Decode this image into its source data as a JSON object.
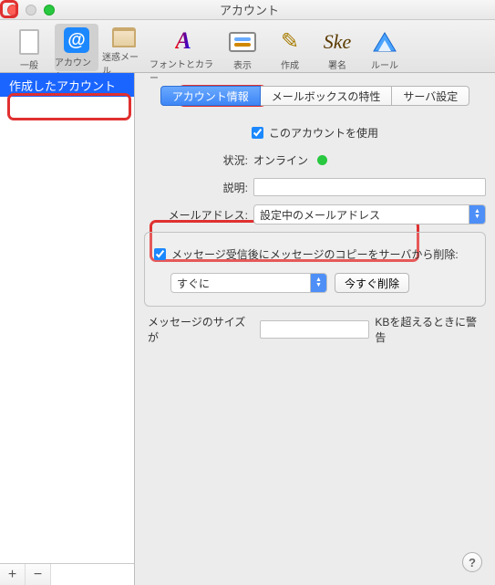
{
  "window": {
    "title": "アカウント"
  },
  "toolbar": [
    {
      "key": "general",
      "label": "一般"
    },
    {
      "key": "accounts",
      "label": "アカウント",
      "selected": true
    },
    {
      "key": "junk",
      "label": "迷惑メール"
    },
    {
      "key": "fonts",
      "label": "フォントとカラー"
    },
    {
      "key": "viewing",
      "label": "表示"
    },
    {
      "key": "compose",
      "label": "作成"
    },
    {
      "key": "sign",
      "label": "署名"
    },
    {
      "key": "rules",
      "label": "ルール"
    }
  ],
  "sidebar": {
    "items": [
      {
        "label": "作成したアカウント",
        "selected": true
      }
    ],
    "add": "+",
    "remove": "−"
  },
  "tabs": [
    {
      "label": "アカウント情報",
      "selected": true
    },
    {
      "label": "メールボックスの特性"
    },
    {
      "label": "サーバ設定"
    }
  ],
  "form": {
    "use_account_label": "このアカウントを使用",
    "use_account_checked": true,
    "status_label": "状況:",
    "status_value": "オンライン",
    "desc_label": "説明:",
    "desc_value": "",
    "email_label": "メールアドレス:",
    "email_value": "設定中のメールアドレス",
    "remove_copies_checked": true,
    "remove_copies_label": "メッセージ受信後にメッセージのコピーをサーバから削除:",
    "remove_when_value": "すぐに",
    "remove_now_label": "今すぐ削除",
    "size_limit_prefix": "メッセージのサイズが",
    "size_limit_value": "",
    "size_limit_suffix": "KBを超えるときに警告"
  },
  "help": "?"
}
